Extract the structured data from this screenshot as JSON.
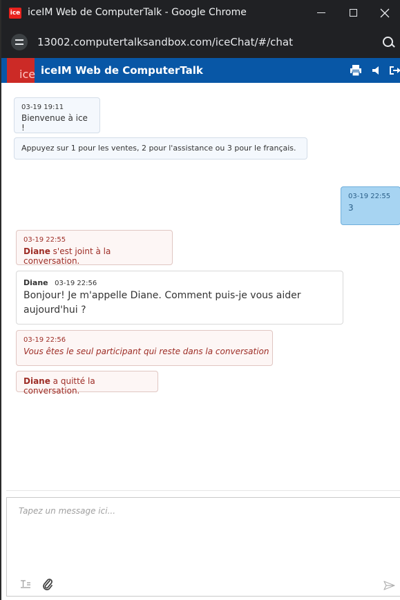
{
  "window": {
    "title": "iceIM Web de ComputerTalk - Google Chrome",
    "app_icon_text": "ice"
  },
  "browser": {
    "url": "13002.computertalksandbox.com/iceChat/#/chat"
  },
  "header": {
    "logo_text": "ice",
    "title": "iceIM Web de ComputerTalk",
    "brand_color": "#0857a6",
    "logo_color": "#cc2a26"
  },
  "messages": {
    "welcome": {
      "time": "03-19 19:11",
      "text": "Bienvenue à ice !"
    },
    "menu": {
      "text": "Appuyez sur 1 pour les ventes, 2 pour l'assistance ou 3 pour le français."
    },
    "user_reply": {
      "time": "03-19 22:55",
      "text": "3"
    },
    "joined": {
      "time": "03-19 22:55",
      "name": "Diane",
      "text": " s'est joint à la conversation."
    },
    "agent_msg": {
      "name": "Diane",
      "time": "03-19 22:56",
      "text": "Bonjour! Je m'appelle Diane. Comment puis-je vous aider aujourd'hui ?"
    },
    "alone": {
      "time": "03-19 22:56",
      "text": "Vous êtes le seul participant qui reste dans la conversation"
    },
    "left": {
      "name": "Diane",
      "text": " a quitté la conversation."
    }
  },
  "composer": {
    "placeholder": "Tapez un message ici..."
  },
  "icons": [
    "minimize-icon",
    "maximize-icon",
    "close-icon",
    "site-info-icon",
    "zoom-icon",
    "print-icon",
    "sound-icon",
    "exit-icon",
    "format-icon",
    "attach-icon",
    "send-icon"
  ]
}
